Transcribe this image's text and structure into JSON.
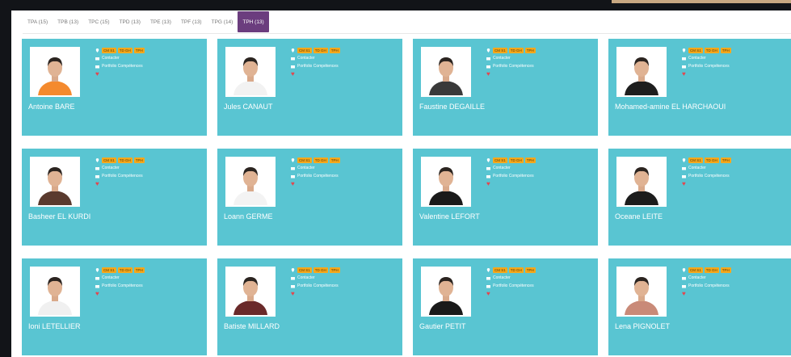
{
  "tabs": [
    {
      "label": "TPA (15)",
      "active": false
    },
    {
      "label": "TPB (13)",
      "active": false
    },
    {
      "label": "TPC (15)",
      "active": false
    },
    {
      "label": "TPD (13)",
      "active": false
    },
    {
      "label": "TPE (13)",
      "active": false
    },
    {
      "label": "TPF (13)",
      "active": false
    },
    {
      "label": "TPG (14)",
      "active": false
    },
    {
      "label": "TPH (13)",
      "active": true
    }
  ],
  "card_labels": {
    "badges": [
      "CM S1",
      "TD GH",
      "TPH"
    ],
    "contact": "Contacter",
    "portfolio": "Portfolio Compétences"
  },
  "students": [
    {
      "name": "Antoine BARE",
      "shirt": "#f48a2e"
    },
    {
      "name": "Jules CANAUT",
      "shirt": "#f2f2f2"
    },
    {
      "name": "Faustine DEGAILLE",
      "shirt": "#3a3a3a"
    },
    {
      "name": "Mohamed-amine EL HARCHAOUI",
      "shirt": "#1e1e1e"
    },
    {
      "name": "Basheer EL KURDI",
      "shirt": "#5a3a2e"
    },
    {
      "name": "Loann GERME",
      "shirt": "#f3f3f3"
    },
    {
      "name": "Valentine LEFORT",
      "shirt": "#1a1a1a"
    },
    {
      "name": "Oceane LEITE",
      "shirt": "#1c1c1c"
    },
    {
      "name": "Ioni LETELLIER",
      "shirt": "#f0f0f0"
    },
    {
      "name": "Batiste MILLARD",
      "shirt": "#6a2a2a"
    },
    {
      "name": "Gautier PETIT",
      "shirt": "#1a1a1a"
    },
    {
      "name": "Lena PIGNOLET",
      "shirt": "#c98a78"
    }
  ],
  "colors": {
    "card_bg": "#59c5d2",
    "active_tab": "#6b3d7e",
    "badge": "#f5a81c",
    "heart": "#e2464f"
  }
}
